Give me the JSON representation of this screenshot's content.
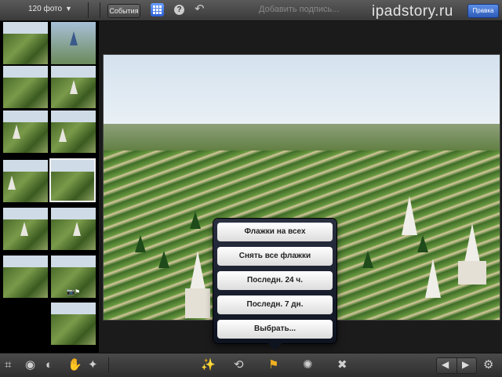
{
  "toolbar": {
    "photo_count": "120 фото",
    "events_label": "События",
    "help_glyph": "?",
    "caption_placeholder": "Добавить подпись...",
    "watermark": "ipadstory.ru",
    "edit_label": "Правка"
  },
  "sidebar": {
    "thumbnail_count": 14,
    "selected_index": 7
  },
  "flag_menu": {
    "items": [
      "Флажки на всех",
      "Снять все флажки",
      "Последн. 24 ч.",
      "Последн. 7 дн.",
      "Выбрать..."
    ]
  },
  "bottom_toolbar": {
    "left_tools": [
      "crop-icon",
      "palette-circle-icon",
      "color-palette-icon",
      "brushes-icon",
      "effects-icon"
    ],
    "center_tools": [
      "magic-wand-icon",
      "rotate-icon",
      "flag-icon",
      "gear-stamp-icon",
      "delete-icon"
    ],
    "active_tool": "flag-icon"
  },
  "colors": {
    "accent_blue": "#2d5bb8",
    "flag_active": "#f0b020",
    "toolbar_bg": "#3a3a3a"
  }
}
